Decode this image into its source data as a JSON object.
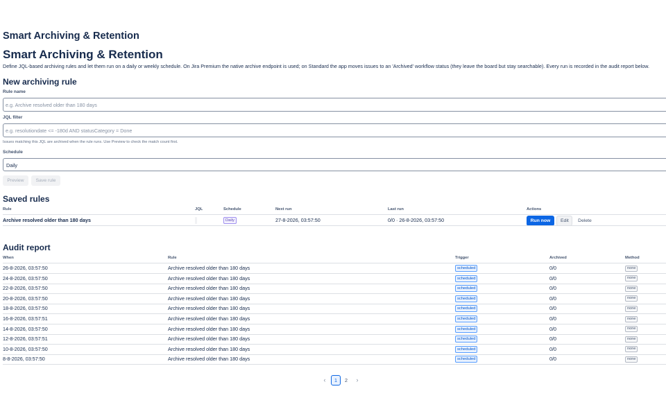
{
  "app": {
    "title": "Smart Archiving & Retention"
  },
  "page": {
    "title": "Smart Archiving & Retention",
    "description": "Define JQL-based archiving rules and let them run on a daily or weekly schedule. On Jira Premium the native archive endpoint is used; on Standard the app moves issues to an 'Archived' workflow status (they leave the board but stay searchable). Every run is recorded in the audit report below."
  },
  "new_rule": {
    "title": "New archiving rule",
    "name_label": "Rule name",
    "name_placeholder": "e.g. Archive resolved older than 180 days",
    "name_value": "",
    "jql_label": "JQL filter",
    "jql_placeholder": "e.g. resolutiondate <= -180d AND statusCategory = Done",
    "jql_value": "",
    "jql_helper": "Issues matching this JQL are archived when the rule runs. Use Preview to check the match count first.",
    "schedule_label": "Schedule",
    "schedule_value": "Daily",
    "preview_label": "Preview",
    "save_label": "Save rule"
  },
  "saved_rules": {
    "title": "Saved rules",
    "columns": [
      "Rule",
      "JQL",
      "Schedule",
      "Next run",
      "Last run",
      "Actions"
    ],
    "rows": [
      {
        "rule": "Archive resolved older than 180 days",
        "jql": "",
        "schedule": "Daily",
        "next_run": "27-8-2026, 03:57:50",
        "last_run": "0/0 · 26-8-2026, 03:57:50",
        "run_now": "Run now",
        "edit": "Edit",
        "delete": "Delete"
      }
    ]
  },
  "audit": {
    "title": "Audit report",
    "columns": [
      "When",
      "Rule",
      "Trigger",
      "Archived",
      "Method"
    ],
    "rows": [
      {
        "when": "26-8-2026, 03:57:50",
        "rule": "Archive resolved older than 180 days",
        "trigger": "scheduled",
        "archived": "0/0",
        "method": "none"
      },
      {
        "when": "24-8-2026, 03:57:50",
        "rule": "Archive resolved older than 180 days",
        "trigger": "scheduled",
        "archived": "0/0",
        "method": "none"
      },
      {
        "when": "22-8-2026, 03:57:50",
        "rule": "Archive resolved older than 180 days",
        "trigger": "scheduled",
        "archived": "0/0",
        "method": "none"
      },
      {
        "when": "20-8-2026, 03:57:50",
        "rule": "Archive resolved older than 180 days",
        "trigger": "scheduled",
        "archived": "0/0",
        "method": "none"
      },
      {
        "when": "18-8-2026, 03:57:50",
        "rule": "Archive resolved older than 180 days",
        "trigger": "scheduled",
        "archived": "0/0",
        "method": "none"
      },
      {
        "when": "16-8-2026, 03:57:51",
        "rule": "Archive resolved older than 180 days",
        "trigger": "scheduled",
        "archived": "0/0",
        "method": "none"
      },
      {
        "when": "14-8-2026, 03:57:50",
        "rule": "Archive resolved older than 180 days",
        "trigger": "scheduled",
        "archived": "0/0",
        "method": "none"
      },
      {
        "when": "12-8-2026, 03:57:51",
        "rule": "Archive resolved older than 180 days",
        "trigger": "scheduled",
        "archived": "0/0",
        "method": "none"
      },
      {
        "when": "10-8-2026, 03:57:50",
        "rule": "Archive resolved older than 180 days",
        "trigger": "scheduled",
        "archived": "0/0",
        "method": "none"
      },
      {
        "when": "8-8-2026, 03:57:50",
        "rule": "Archive resolved older than 180 days",
        "trigger": "scheduled",
        "archived": "0/0",
        "method": "none"
      }
    ]
  },
  "pagination": {
    "pages": [
      "1",
      "2"
    ],
    "current": "1",
    "prev_icon": "chevron-left-icon",
    "next_icon": "chevron-right-icon"
  },
  "colors": {
    "primary": "#0c66e4",
    "text": "#172b4d",
    "subtle_text": "#44546f",
    "border": "#dcdfe4"
  }
}
